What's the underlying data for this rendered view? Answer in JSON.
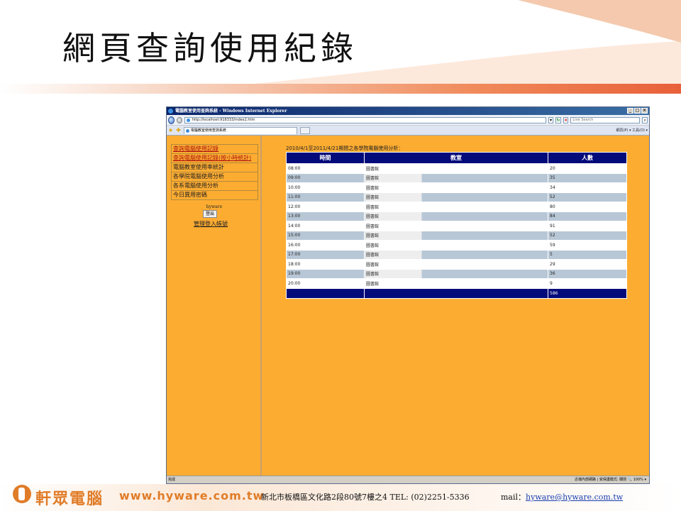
{
  "slide": {
    "title": "網頁查詢使用紀錄"
  },
  "browser": {
    "window_title": "電腦教室使用查詢系統 - Windows Internet Explorer",
    "address": "http://localhost:918333/index2.htm",
    "search_placeholder": "Live Search",
    "tab_title": "電腦教室使用查詢系統",
    "command_bar": "網頁(P) ▾ 工具(O) ▾",
    "status_left": "完成",
    "status_zone": "近端內部網路 | 受保護模式: 關閉",
    "zoom": "100%"
  },
  "sidebar": {
    "menu": [
      {
        "label": "查詢電腦使用記錄",
        "link": true
      },
      {
        "label": "查詢電腦使用記錄(按小時統計)",
        "link": true
      },
      {
        "label": "電腦教室使用率統計",
        "link": false
      },
      {
        "label": "各學院電腦使用分析",
        "link": false
      },
      {
        "label": "各系電腦使用分析",
        "link": false
      },
      {
        "label": "今日異用密碼",
        "link": false
      }
    ],
    "user": "hyware",
    "logout_label": "登出",
    "admin_link": "管理登入帳號"
  },
  "report": {
    "caption": "2010/4/1至2011/4/21期間之各學院電腦使用分析：",
    "headers": [
      "時間",
      "教室",
      "人數"
    ],
    "rows": [
      {
        "time": "08:00",
        "room": "圖書館",
        "count": "20"
      },
      {
        "time": "09:00",
        "room": "圖書館",
        "count": "35"
      },
      {
        "time": "10:00",
        "room": "圖書館",
        "count": "34"
      },
      {
        "time": "11:00",
        "room": "圖書館",
        "count": "52"
      },
      {
        "time": "12:00",
        "room": "圖書館",
        "count": "80"
      },
      {
        "time": "13:00",
        "room": "圖書館",
        "count": "84"
      },
      {
        "time": "14:00",
        "room": "圖書館",
        "count": "91"
      },
      {
        "time": "15:00",
        "room": "圖書館",
        "count": "52"
      },
      {
        "time": "16:00",
        "room": "圖書館",
        "count": "59"
      },
      {
        "time": "17:00",
        "room": "圖書館",
        "count": "5"
      },
      {
        "time": "18:00",
        "room": "圖書館",
        "count": "29"
      },
      {
        "time": "19:00",
        "room": "圖書館",
        "count": "36"
      },
      {
        "time": "20:00",
        "room": "圖書館",
        "count": "9"
      }
    ],
    "total": "586"
  },
  "footer": {
    "brand": "軒眾電腦",
    "website": "www.hyware.com.tw",
    "address": "新北市板橋區文化路2段80號7樓之4  TEL: (02)2251-5336",
    "mail_label": "mail：",
    "mail": "hyware@hyware.com.tw"
  },
  "colors": {
    "page_bg": "#fcac31",
    "table_header": "#030a7a",
    "row_alt": "#b8c7d6",
    "brand_orange": "#e07c28"
  }
}
